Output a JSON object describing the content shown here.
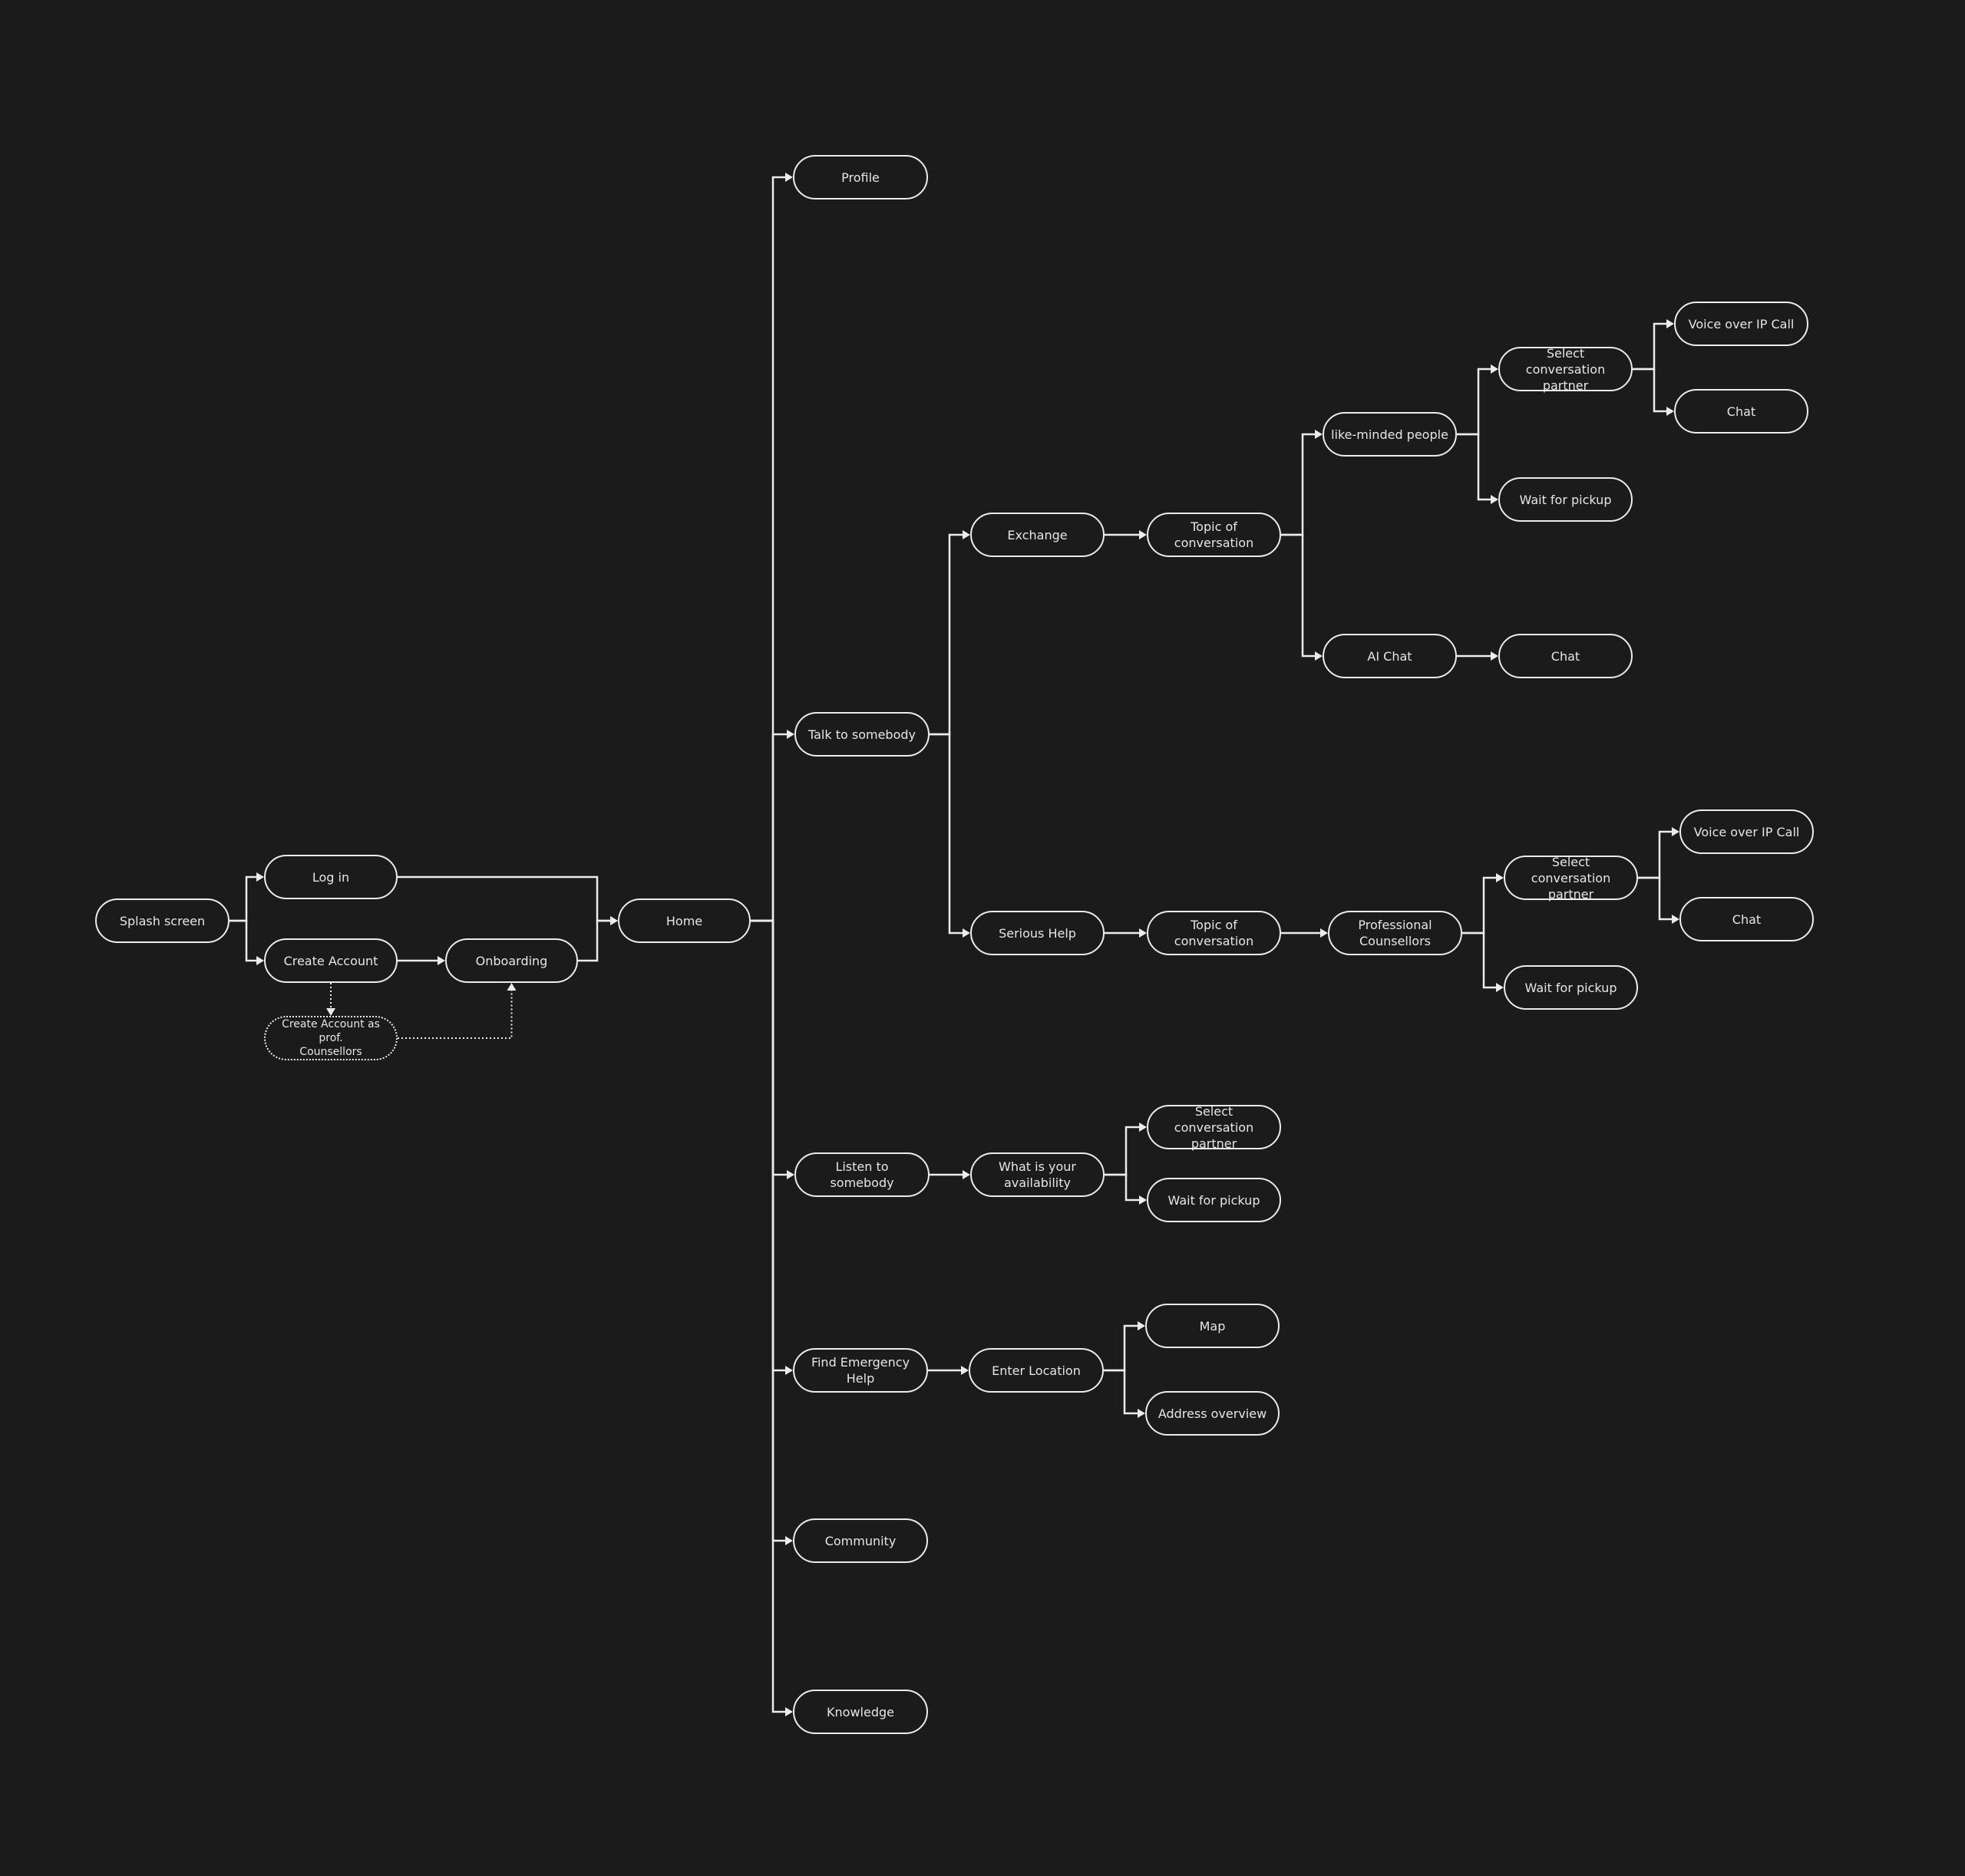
{
  "diagram": {
    "title": "",
    "colors": {
      "background": "#1b1b1b",
      "stroke": "#ececec",
      "text": "#e6e6e6"
    },
    "nodes": {
      "splash": "Splash screen",
      "login": "Log in",
      "create_account": "Create Account",
      "onboarding": "Onboarding",
      "create_account_prof": "Create Account as  prof.\nCounsellors",
      "home": "Home",
      "profile": "Profile",
      "talk": "Talk to somebody",
      "exchange": "Exchange",
      "exchange_topic": "Topic of\nconversation",
      "like_minded": "like-minded people",
      "lm_select_partner": "Select conversation\npartner",
      "lm_voip": "Voice over IP Call",
      "lm_chat": "Chat",
      "lm_wait": "Wait for pickup",
      "ai_chat": "AI Chat",
      "ai_chat_chat": "Chat",
      "serious_help": "Serious Help",
      "serious_topic": "Topic of\nconversation",
      "prof_counsellors": "Professional\nCounsellors",
      "pc_select_partner": "Select conversation\npartner",
      "pc_voip": "Voice over IP Call",
      "pc_chat": "Chat",
      "pc_wait": "Wait for pickup",
      "listen": "Listen to somebody",
      "availability": "What is your\navailability",
      "listen_select_partner": "Select conversation\npartner",
      "listen_wait": "Wait for pickup",
      "emergency": "Find Emergency\nHelp",
      "enter_location": "Enter Location",
      "map": "Map",
      "address_overview": "Address overview",
      "community": "Community",
      "knowledge": "Knowledge"
    },
    "edges": [
      {
        "from": "splash",
        "to": "login",
        "style": "solid"
      },
      {
        "from": "splash",
        "to": "create_account",
        "style": "solid"
      },
      {
        "from": "create_account",
        "to": "onboarding",
        "style": "solid"
      },
      {
        "from": "create_account",
        "to": "create_account_prof",
        "style": "dotted"
      },
      {
        "from": "create_account_prof",
        "to": "onboarding",
        "style": "dotted"
      },
      {
        "from": "login",
        "to": "home",
        "style": "solid"
      },
      {
        "from": "onboarding",
        "to": "home",
        "style": "solid"
      },
      {
        "from": "home",
        "to": "profile",
        "style": "solid"
      },
      {
        "from": "home",
        "to": "talk",
        "style": "solid"
      },
      {
        "from": "home",
        "to": "listen",
        "style": "solid"
      },
      {
        "from": "home",
        "to": "emergency",
        "style": "solid"
      },
      {
        "from": "home",
        "to": "community",
        "style": "solid"
      },
      {
        "from": "home",
        "to": "knowledge",
        "style": "solid"
      },
      {
        "from": "talk",
        "to": "exchange",
        "style": "solid"
      },
      {
        "from": "talk",
        "to": "serious_help",
        "style": "solid"
      },
      {
        "from": "exchange",
        "to": "exchange_topic",
        "style": "solid"
      },
      {
        "from": "exchange_topic",
        "to": "like_minded",
        "style": "solid"
      },
      {
        "from": "exchange_topic",
        "to": "ai_chat",
        "style": "solid"
      },
      {
        "from": "like_minded",
        "to": "lm_select_partner",
        "style": "solid"
      },
      {
        "from": "like_minded",
        "to": "lm_wait",
        "style": "solid"
      },
      {
        "from": "lm_select_partner",
        "to": "lm_voip",
        "style": "solid"
      },
      {
        "from": "lm_select_partner",
        "to": "lm_chat",
        "style": "solid"
      },
      {
        "from": "ai_chat",
        "to": "ai_chat_chat",
        "style": "solid"
      },
      {
        "from": "serious_help",
        "to": "serious_topic",
        "style": "solid"
      },
      {
        "from": "serious_topic",
        "to": "prof_counsellors",
        "style": "solid"
      },
      {
        "from": "prof_counsellors",
        "to": "pc_select_partner",
        "style": "solid"
      },
      {
        "from": "prof_counsellors",
        "to": "pc_wait",
        "style": "solid"
      },
      {
        "from": "pc_select_partner",
        "to": "pc_voip",
        "style": "solid"
      },
      {
        "from": "pc_select_partner",
        "to": "pc_chat",
        "style": "solid"
      },
      {
        "from": "listen",
        "to": "availability",
        "style": "solid"
      },
      {
        "from": "availability",
        "to": "listen_select_partner",
        "style": "solid"
      },
      {
        "from": "availability",
        "to": "listen_wait",
        "style": "solid"
      },
      {
        "from": "emergency",
        "to": "enter_location",
        "style": "solid"
      },
      {
        "from": "enter_location",
        "to": "map",
        "style": "solid"
      },
      {
        "from": "enter_location",
        "to": "address_overview",
        "style": "solid"
      }
    ]
  }
}
